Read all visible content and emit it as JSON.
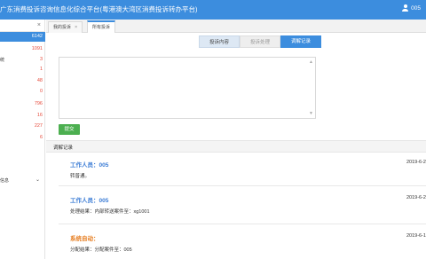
{
  "header": {
    "title": "广东消费投诉咨询信息化综合平台(粤港澳大湾区消费投诉转办平台)",
    "user": "005"
  },
  "sidebar": {
    "items": [
      {
        "label": "",
        "count": "6142",
        "active": true
      },
      {
        "label": "",
        "count": "1091",
        "active": false
      },
      {
        "label": "统",
        "count": "3",
        "active": false
      },
      {
        "label": "",
        "count": "1",
        "active": false
      },
      {
        "label": "",
        "count": "48",
        "active": false
      },
      {
        "label": "",
        "count": "0",
        "active": false
      },
      {
        "label": "",
        "count": "796",
        "active": false
      },
      {
        "label": "",
        "count": "16",
        "active": false
      },
      {
        "label": "",
        "count": "227",
        "active": false
      },
      {
        "label": "",
        "count": "6",
        "active": false
      }
    ],
    "section_label": "信息"
  },
  "tabs": [
    {
      "label": "我的投诉",
      "close": "×",
      "active": false
    },
    {
      "label": "所有投诉",
      "close": "",
      "active": true
    }
  ],
  "segments": [
    "投诉内容",
    "投诉处理",
    "调解记录"
  ],
  "submit_label": "提交",
  "records_title": "调解记录",
  "records": [
    {
      "who": "工作人员：005",
      "date": "2019-6-2",
      "text": "转普通。",
      "system": false
    },
    {
      "who": "工作人员：005",
      "date": "2019-6-2",
      "text": "处理结果：内部转送案件至：xg1001",
      "system": false
    },
    {
      "who": "系统自动：",
      "date": "2019-6-1",
      "text": "分配结果：分配案件至：005",
      "system": true
    }
  ],
  "colors": {
    "primary": "#3c8dde",
    "submit": "#4caf50",
    "count": "#e64a3b",
    "system": "#e67e22"
  }
}
